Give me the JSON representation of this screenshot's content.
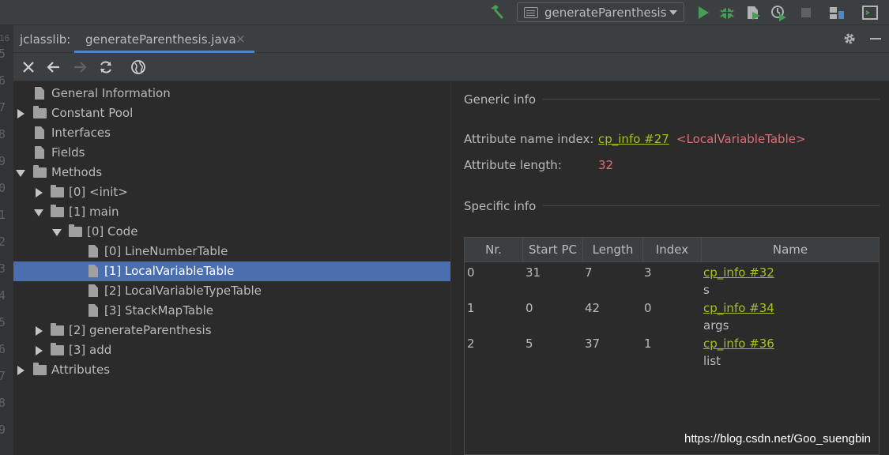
{
  "toolbar": {
    "run_config": "generateParenthesis",
    "colors": {
      "green": "#499c54",
      "gray": "#5f6163"
    }
  },
  "gutter": {
    "numbers": [
      "5",
      "6",
      "7",
      "8",
      "9",
      "0",
      "1",
      "2",
      "3",
      "4",
      "5",
      "6",
      "7",
      "8",
      "9"
    ],
    "top_partial": "16"
  },
  "tabs": {
    "prefix": "jclasslib:",
    "active": "generateParenthesis.java",
    "close_glyph": "×"
  },
  "tree": {
    "items": [
      {
        "label": "General Information",
        "icon": "file-icon",
        "level": 0,
        "expander": "none"
      },
      {
        "label": "Constant Pool",
        "icon": "folder-icon",
        "level": 0,
        "expander": "collapsed"
      },
      {
        "label": "Interfaces",
        "icon": "file-icon",
        "level": 0,
        "expander": "none"
      },
      {
        "label": "Fields",
        "icon": "file-icon",
        "level": 0,
        "expander": "none"
      },
      {
        "label": "Methods",
        "icon": "folder-icon",
        "level": 0,
        "expander": "expanded"
      },
      {
        "label": "[0] <init>",
        "icon": "folder-icon",
        "level": 1,
        "expander": "collapsed"
      },
      {
        "label": "[1] main",
        "icon": "folder-icon",
        "level": 1,
        "expander": "expanded"
      },
      {
        "label": "[0] Code",
        "icon": "folder-icon",
        "level": 2,
        "expander": "expanded"
      },
      {
        "label": "[0] LineNumberTable",
        "icon": "file-icon",
        "level": 3,
        "expander": "none"
      },
      {
        "label": "[1] LocalVariableTable",
        "icon": "file-icon",
        "level": 3,
        "expander": "none",
        "selected": true
      },
      {
        "label": "[2] LocalVariableTypeTable",
        "icon": "file-icon",
        "level": 3,
        "expander": "none"
      },
      {
        "label": "[3] StackMapTable",
        "icon": "file-icon",
        "level": 3,
        "expander": "none"
      },
      {
        "label": "[2] generateParenthesis",
        "icon": "folder-icon",
        "level": 1,
        "expander": "collapsed"
      },
      {
        "label": "[3] add",
        "icon": "folder-icon",
        "level": 1,
        "expander": "collapsed"
      },
      {
        "label": "Attributes",
        "icon": "folder-icon",
        "level": 0,
        "expander": "collapsed"
      }
    ]
  },
  "details": {
    "generic_title": "Generic info",
    "name_index_label": "Attribute name index:",
    "name_index_link": "cp_info #27",
    "name_index_value": "<LocalVariableTable>",
    "length_label": "Attribute length:",
    "length_value": "32",
    "specific_title": "Specific info",
    "table": {
      "headers": [
        "Nr.",
        "Start PC",
        "Length",
        "Index",
        "Name"
      ],
      "rows": [
        {
          "nr": "0",
          "start_pc": "31",
          "length": "7",
          "index": "3",
          "name_link": "cp_info #32",
          "name_value": "s"
        },
        {
          "nr": "1",
          "start_pc": "0",
          "length": "42",
          "index": "0",
          "name_link": "cp_info #34",
          "name_value": "args"
        },
        {
          "nr": "2",
          "start_pc": "5",
          "length": "37",
          "index": "1",
          "name_link": "cp_info #36",
          "name_value": "list"
        }
      ]
    }
  },
  "watermark": "https://blog.csdn.net/Goo_suengbin",
  "colors": {
    "background": "#2b2b2b",
    "panel": "#3c3f41",
    "selection": "#4b6eaf",
    "link": "#a8c023",
    "value_red": "#e06c75",
    "tab_underline": "#4a88c7"
  }
}
